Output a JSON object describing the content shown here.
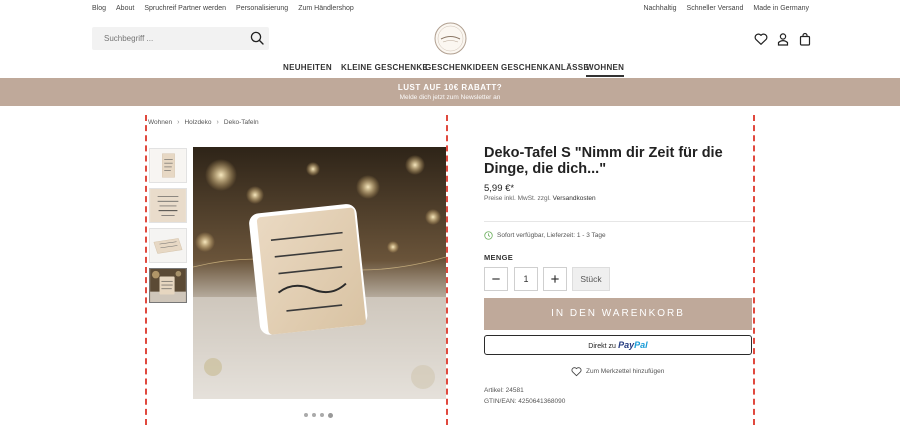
{
  "topbar": {
    "left": [
      "Blog",
      "About",
      "Spruchreif Partner werden",
      "Personalisierung",
      "Zum Händlershop"
    ],
    "right": [
      "Nachhaltig",
      "Schneller Versand",
      "Made in Germany"
    ]
  },
  "search": {
    "placeholder": "Suchbegriff ..."
  },
  "nav": [
    "NEUHEITEN",
    "KLEINE GESCHENKE",
    "GESCHENKIDEEN",
    "GESCHENKANLÄSSE",
    "WOHNEN"
  ],
  "promo": {
    "headline": "LUST AUF 10€ RABATT?",
    "subline": "Melde dich jetzt zum Newsletter an"
  },
  "breadcrumb": [
    "Wohnen",
    "Holzdeko",
    "Deko-Tafeln"
  ],
  "product": {
    "title": "Deko-Tafel S \"Nimm dir Zeit für die Dinge, die dich...\"",
    "price": "5,99 €*",
    "tax_text": "Preise inkl. MwSt. zzgl.",
    "shipping_link": "Versandkosten",
    "availability": "Sofort verfügbar, Lieferzeit: 1 - 3 Tage",
    "quantity_label": "MENGE",
    "quantity": "1",
    "unit": "Stück",
    "add_to_cart": "IN DEN WARENKORB",
    "paypal_prefix": "Direkt zu",
    "paypal_brand_1": "Pay",
    "paypal_brand_2": "Pal",
    "wishlist": "Zum Merkzettel hinzufügen",
    "article": "Artikel: 24581",
    "gtin": "GTIN/EAN: 4250641368090"
  },
  "icons": [
    "search-icon",
    "heart-icon",
    "user-icon",
    "bag-icon",
    "clock-icon",
    "minus-icon",
    "plus-icon"
  ],
  "colors": {
    "accent": "#bfa99a",
    "guide": "#e0493e"
  }
}
